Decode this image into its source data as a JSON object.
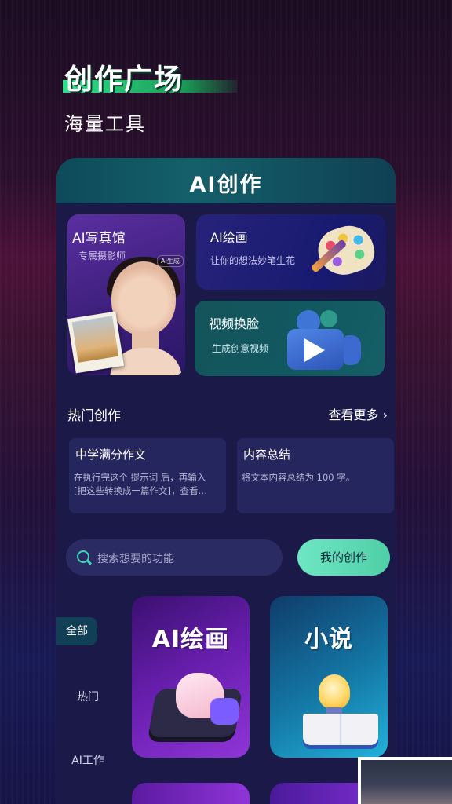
{
  "hero": {
    "title": "创作广场",
    "subtitle": "海量工具"
  },
  "panel": {
    "title": "AI创作"
  },
  "features": {
    "portrait": {
      "title": "AI写真馆",
      "subtitle": "专属摄影师",
      "tag": "AI生成"
    },
    "drawing": {
      "title": "AI绘画",
      "subtitle": "让你的想法妙笔生花"
    },
    "video": {
      "title": "视频换脸",
      "subtitle": "生成创意视频"
    }
  },
  "hot_section": {
    "title": "热门创作",
    "more_label": "查看更多 ›",
    "items": [
      {
        "title": "中学满分作文",
        "desc": "在执行完这个 提示词 后，再输入 [把这些转换成一篇作文]，查看…"
      },
      {
        "title": "内容总结",
        "desc": "将文本内容总结为 100 字。"
      }
    ]
  },
  "search": {
    "placeholder": "搜索想要的功能"
  },
  "my_creations_button": "我的创作",
  "categories": [
    {
      "label": "全部",
      "active": true
    },
    {
      "label": "热门",
      "active": false
    },
    {
      "label": "AI工作",
      "active": false
    }
  ],
  "tiles": [
    {
      "label": "AI绘画",
      "icon": "hand-on-pad-icon"
    },
    {
      "label": "小说",
      "icon": "book-lightbulb-icon"
    }
  ],
  "colors": {
    "accent_green": "#4fcfa6",
    "panel_bg": "#1a1948",
    "search_icon": "#3ed8b6"
  }
}
